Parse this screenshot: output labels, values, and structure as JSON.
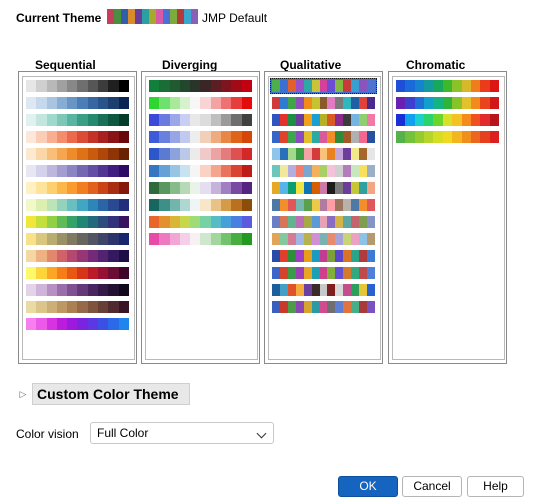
{
  "current_theme": {
    "label": "Current Theme",
    "name": "JMP Default",
    "swatch": [
      "#c4405a",
      "#4a8f3e",
      "#2e5fa8",
      "#d98a2b",
      "#6a3d9a",
      "#2ca0a0",
      "#a6aa2a",
      "#d65aa8",
      "#4b6fd4",
      "#7aab3b",
      "#b33a3a",
      "#3aa7d0",
      "#8a5fb5"
    ]
  },
  "columns": [
    {
      "title": "Sequential",
      "palettes": [
        [
          "#e6e6e6",
          "#cfcfcf",
          "#b8b8b8",
          "#a0a0a0",
          "#888888",
          "#6f6f6f",
          "#565656",
          "#3c3c3c",
          "#1f1f1f",
          "#000000"
        ],
        [
          "#dde8f3",
          "#c6d8ec",
          "#a8c4e1",
          "#87add4",
          "#6894c6",
          "#4b7db6",
          "#3766a2",
          "#29538b",
          "#1c3f70",
          "#0c2452"
        ],
        [
          "#dff2ef",
          "#c2e6df",
          "#9fd8cc",
          "#7cc7b7",
          "#58b5a1",
          "#3b9f88",
          "#278870",
          "#187058",
          "#0c5843",
          "#043c2c"
        ],
        [
          "#fde6da",
          "#fbcdb7",
          "#f8ae90",
          "#f48d6b",
          "#ec6a4c",
          "#dc4b36",
          "#c43328",
          "#a8211f",
          "#8a1316",
          "#66080c"
        ],
        [
          "#fde9cf",
          "#fbd6a7",
          "#f9bf79",
          "#f6a64e",
          "#ee8c2c",
          "#df7217",
          "#c95b0d",
          "#ae4709",
          "#8e3406",
          "#692303"
        ],
        [
          "#e8e6f3",
          "#d4d1ea",
          "#bdb7de",
          "#a49ed0",
          "#8b85c1",
          "#7468b3",
          "#634fa3",
          "#523492",
          "#401c80",
          "#2b0b66"
        ],
        [
          "#fff1c1",
          "#fee49a",
          "#fdd06f",
          "#fcb74b",
          "#fa9b30",
          "#f27e22",
          "#e2611c",
          "#c94516",
          "#a82d11",
          "#83180b"
        ],
        [
          "#f2f8c8",
          "#dcefb0",
          "#bde4b6",
          "#93d3bd",
          "#67bfc1",
          "#42a5c1",
          "#2e86b8",
          "#2b65a6",
          "#294993",
          "#22307b"
        ],
        [
          "#f1e73a",
          "#c3df3c",
          "#8fd044",
          "#5ebb55",
          "#35a267",
          "#1f8773",
          "#21697b",
          "#2a4d7e",
          "#33317b",
          "#3a1260"
        ],
        [
          "#f7e28a",
          "#d8c77d",
          "#b9ac71",
          "#9b9166",
          "#807a63",
          "#66655e",
          "#525562",
          "#3f4566",
          "#2b356b",
          "#182670"
        ],
        [
          "#f5d7a3",
          "#eeb184",
          "#e2886d",
          "#d0636a",
          "#b5486f",
          "#963675",
          "#752a79",
          "#532271",
          "#351960",
          "#1d0f45"
        ],
        [
          "#fef96a",
          "#fdd53b",
          "#fba723",
          "#f67d18",
          "#e95715",
          "#d63519",
          "#bb1b26",
          "#971232",
          "#6d0d35",
          "#3e062a"
        ],
        [
          "#e3d3e8",
          "#cfb3d8",
          "#b68fc3",
          "#9a6eab",
          "#7f5092",
          "#643879",
          "#4a2660",
          "#351a49",
          "#231033",
          "#12071d"
        ],
        [
          "#e9dba1",
          "#dbc58b",
          "#ccaf76",
          "#bd9864",
          "#ab8154",
          "#966a48",
          "#7f543f",
          "#683f37",
          "#512a2f",
          "#391524"
        ],
        [
          "#f77ff0",
          "#eb5ae9",
          "#d733e2",
          "#bb1ddd",
          "#9d19de",
          "#7b24e0",
          "#5b38e3",
          "#3b4fe5",
          "#2c69e8",
          "#1f86ec"
        ]
      ]
    },
    {
      "title": "Diverging",
      "palettes": [
        [
          "#12803b",
          "#1a6d35",
          "#1f5a30",
          "#23472c",
          "#283528",
          "#3a2626",
          "#5c1e22",
          "#7e151e",
          "#a00b17",
          "#c30012"
        ],
        [
          "#2fd62f",
          "#6ee06e",
          "#a6ea9a",
          "#d6f2cc",
          "#f7f7f7",
          "#f9d4d4",
          "#f4a3a3",
          "#ee7272",
          "#e83d3d",
          "#e30b0b"
        ],
        [
          "#3a49d6",
          "#6a7ae0",
          "#9aa7e9",
          "#c8cff2",
          "#e8e8e8",
          "#dcdcdc",
          "#bfbfbf",
          "#9a9a9a",
          "#6f6f6f",
          "#404040"
        ],
        [
          "#3d5bd8",
          "#6a80df",
          "#95a5e6",
          "#c1c9ee",
          "#ededed",
          "#f1cfb8",
          "#edab7e",
          "#e88646",
          "#e0631a",
          "#d64608"
        ],
        [
          "#2c56c9",
          "#5b7bd3",
          "#8ba2dd",
          "#bac9e7",
          "#ebebeb",
          "#f2c9c9",
          "#eca3a3",
          "#e57b7b",
          "#dd5151",
          "#d42727"
        ],
        [
          "#3476c4",
          "#65a0d6",
          "#97c6e4",
          "#c9e2f1",
          "#f5f5f5",
          "#fbd1c4",
          "#f5a58e",
          "#e9735d",
          "#d84332",
          "#bf1c17"
        ],
        [
          "#2d6b3c",
          "#5a9661",
          "#87bb89",
          "#b8d9b6",
          "#eaf3e8",
          "#e5def0",
          "#c5b3dc",
          "#a080c2",
          "#7a4aa3",
          "#552483"
        ],
        [
          "#15675f",
          "#3d9087",
          "#72b5ad",
          "#aed7d2",
          "#eef5f4",
          "#f7e6c8",
          "#e8c287",
          "#d69a4b",
          "#b9701f",
          "#8c4c0a"
        ],
        [
          "#e8662b",
          "#e3902f",
          "#d9b636",
          "#c7d64a",
          "#9fdc78",
          "#78d1a5",
          "#57bcc5",
          "#47a0da",
          "#4a7fe2",
          "#5c5ade"
        ],
        [
          "#e84aa8",
          "#ee79c0",
          "#f2a6d6",
          "#f5cfe8",
          "#f7f1f4",
          "#cfe8cd",
          "#a1d69d",
          "#72c36b",
          "#47ae42",
          "#229a22"
        ]
      ]
    },
    {
      "title": "Qualitative",
      "palettes": [
        [
          "#4cae4c",
          "#3b6fd1",
          "#e2612b",
          "#9b4fc7",
          "#2fa7a5",
          "#c8c33a",
          "#d4419d",
          "#6c4cd4",
          "#84b941",
          "#c73b3b",
          "#389fd0",
          "#8a54be",
          "#4f73d1"
        ],
        [
          "#d13a3a",
          "#2e7bd1",
          "#3ea548",
          "#8e4fb8",
          "#f08b1c",
          "#c7c22f",
          "#8b5a2b",
          "#e37bc2",
          "#7a7a7a",
          "#2fb7c0",
          "#1f5fa3",
          "#e0413b",
          "#4a2b8b"
        ],
        [
          "#2f56c0",
          "#e3322b",
          "#1d8f45",
          "#6a3d9a",
          "#f1a01b",
          "#1a9fd3",
          "#b6b024",
          "#d95a22",
          "#8c2b8e",
          "#3b3b3b",
          "#73b4e0",
          "#8fcf70",
          "#f07aa5"
        ],
        [
          "#3565c6",
          "#e0432d",
          "#3ea64f",
          "#8b4cc2",
          "#e2c02b",
          "#2baaa4",
          "#d85a9a",
          "#f28c28",
          "#2f8a3a",
          "#a15a2a",
          "#b0b0b0",
          "#f3688e",
          "#2950a0"
        ],
        [
          "#8ec5e8",
          "#2a6fba",
          "#a4d88b",
          "#3a9e44",
          "#f2a3a3",
          "#d63b3b",
          "#f8c27c",
          "#e9821f",
          "#c6a6d8",
          "#6e3c9a",
          "#f2ea8a",
          "#a6682a",
          "#e6e6e6"
        ],
        [
          "#6cc6bd",
          "#f2e89c",
          "#b4aede",
          "#f27d6c",
          "#7aa6d0",
          "#f4b15c",
          "#a9d065",
          "#f4c3d9",
          "#cfcfcf",
          "#b17dbb",
          "#c7e7bf",
          "#f6e05c",
          "#9bb0c6"
        ],
        [
          "#e7a923",
          "#56b4e9",
          "#0b9e73",
          "#f0e442",
          "#0f72b2",
          "#d55e00",
          "#cc79a7",
          "#1c1c1c",
          "#7a7a7a",
          "#6a3d9a",
          "#c6c638",
          "#2fa0a0",
          "#f4a582"
        ],
        [
          "#4e79a7",
          "#f28e2b",
          "#e15759",
          "#76b7b2",
          "#59a14f",
          "#edc948",
          "#b07aa1",
          "#ff9da7",
          "#9c755f",
          "#bab0ac",
          "#4e79a7",
          "#f28e2b",
          "#e15759"
        ],
        [
          "#6a7ec8",
          "#d87556",
          "#63b38f",
          "#bb6fb4",
          "#a9a846",
          "#5b9bd5",
          "#e8a2b5",
          "#8c6cc2",
          "#d4b34a",
          "#5fa5a1",
          "#c4636d",
          "#7d9e4e",
          "#8693c9"
        ],
        [
          "#e0a558",
          "#84c99e",
          "#d47c93",
          "#9fb7e2",
          "#b6b24d",
          "#d18fd6",
          "#79b2b2",
          "#e78a6e",
          "#a7a3d6",
          "#c7d47a",
          "#eba1c1",
          "#8cc2e6",
          "#b49a6e"
        ],
        [
          "#2a4ba8",
          "#e0402b",
          "#2b8f39",
          "#9d3fc1",
          "#e69f1b",
          "#1c9ac0",
          "#c23c91",
          "#7ba03a",
          "#5a46c9",
          "#d9732a",
          "#2aa38d",
          "#b13b3b",
          "#3f7bd4"
        ],
        [
          "#3d65c7",
          "#d5432c",
          "#3b9a46",
          "#9a3fb6",
          "#e8a526",
          "#1ca0b4",
          "#cf3f8b",
          "#82ae3a",
          "#6451d1",
          "#d37a2f",
          "#33a97f",
          "#c04a4a",
          "#4f7fd7"
        ],
        [
          "#1d5f9a",
          "#41a0c8",
          "#e0532a",
          "#f2ab3c",
          "#6b3fa0",
          "#3a2a2a",
          "#c8c8c8",
          "#7f1f1f",
          "#d8d8d8",
          "#c44d8d",
          "#2d9f5c",
          "#e6c53b",
          "#2862d0"
        ],
        [
          "#3960bf",
          "#c8382b",
          "#4d9c48",
          "#8a47b1",
          "#d8a430",
          "#2c9aa5",
          "#d04c8e",
          "#6f6f6f",
          "#5f7fd5",
          "#e0743d",
          "#46ae88",
          "#a83a3a",
          "#7a52c0"
        ]
      ]
    },
    {
      "title": "Chromatic",
      "palettes": [
        [
          "#1e4fd6",
          "#1a6ad9",
          "#1583cf",
          "#139a9d",
          "#17a85d",
          "#3cb82a",
          "#8ac227",
          "#d6b92a",
          "#ef7c1d",
          "#ea3b1b",
          "#dc1515"
        ],
        [
          "#6a1fb3",
          "#3c3fcf",
          "#1f6fd8",
          "#119fcc",
          "#14b383",
          "#2eb539",
          "#86c42a",
          "#e3c12a",
          "#f28b1c",
          "#ea441d",
          "#d11919"
        ],
        [
          "#1a2ed6",
          "#0fa0ee",
          "#1cd0cc",
          "#28d46b",
          "#6ad62a",
          "#d8e02a",
          "#f5c223",
          "#f58a1f",
          "#ef5121",
          "#e22a2a",
          "#b5151b"
        ],
        [
          "#55b24b",
          "#74c13c",
          "#94cc2f",
          "#b5d628",
          "#d6dd25",
          "#f0d823",
          "#f4b61f",
          "#f18f1d",
          "#ec661d",
          "#e5411f",
          "#dc1f1f"
        ]
      ]
    }
  ],
  "custom_color_theme": {
    "label": "Custom Color Theme"
  },
  "color_vision": {
    "label": "Color vision",
    "value": "Full Color"
  },
  "buttons": {
    "ok": "OK",
    "cancel": "Cancel",
    "help": "Help"
  }
}
